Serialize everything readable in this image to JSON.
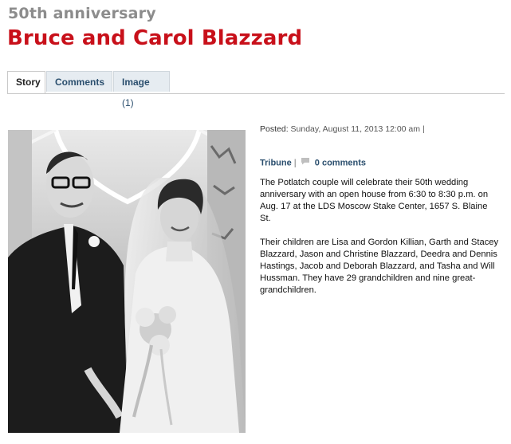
{
  "article": {
    "kicker": "50th anniversary",
    "headline": "Bruce and Carol Blazzard"
  },
  "tabs": [
    {
      "label": "Story",
      "active": true
    },
    {
      "label": "Comments",
      "active": false
    },
    {
      "label": "Image",
      "count": "(1)",
      "active": false
    }
  ],
  "posted": {
    "label": "Posted:",
    "value": "Sunday, August 11, 2013 12:00 am",
    "trail": "|"
  },
  "meta": {
    "source": "Tribune",
    "separator": "|",
    "comments_label": "0 comments",
    "comment_icon": "speech-bubble-icon"
  },
  "story": {
    "paragraphs": [
      "The Potlatch couple will celebrate their 50th wedding anniversary with an open house from 6:30 to 8:30 p.m. on Aug. 17 at the LDS Moscow Stake Center, 1657 S. Blaine St.",
      "Their children are Lisa and Gordon Killian, Garth and Stacey Blazzard, Jason and Christine Blazzard, Deedra and Dennis Hastings, Jacob and Deborah Blazzard, and Tasha and Will Hussman. They have 29 grandchildren and nine great-grandchildren."
    ]
  },
  "colors": {
    "headline": "#c8101a",
    "kicker": "#8c8c8c",
    "link": "#2b4f6e"
  }
}
